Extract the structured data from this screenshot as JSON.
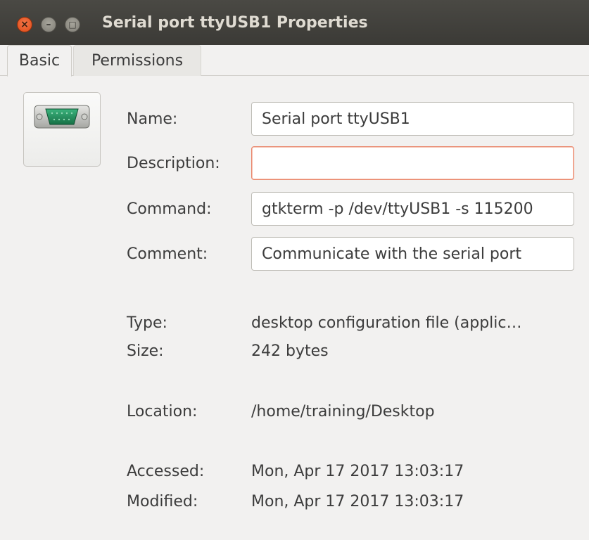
{
  "window": {
    "title": "Serial port ttyUSB1 Properties",
    "buttons": {
      "close_glyph": "×",
      "minimize_glyph": "–",
      "maximize_glyph": "□"
    }
  },
  "tabs": [
    {
      "label": "Basic",
      "active": true
    },
    {
      "label": "Permissions",
      "active": false
    }
  ],
  "icon": {
    "name": "serial-port-icon",
    "color": "#1f8a5a"
  },
  "form": {
    "name": {
      "label": "Name:",
      "value": "Serial port ttyUSB1"
    },
    "description": {
      "label": "Description:",
      "value": "",
      "focused": true
    },
    "command": {
      "label": "Command:",
      "value": "gtkterm -p /dev/ttyUSB1 -s 115200"
    },
    "comment": {
      "label": "Comment:",
      "value": "Communicate with the serial port"
    }
  },
  "info": {
    "type": {
      "label": "Type:",
      "value": "desktop configuration file (applic…"
    },
    "size": {
      "label": "Size:",
      "value": "242 bytes"
    },
    "location": {
      "label": "Location:",
      "value": "/home/training/Desktop"
    },
    "accessed": {
      "label": "Accessed:",
      "value": "Mon, Apr 17 2017 13:03:17"
    },
    "modified": {
      "label": "Modified:",
      "value": "Mon, Apr 17 2017 13:03:17"
    }
  }
}
